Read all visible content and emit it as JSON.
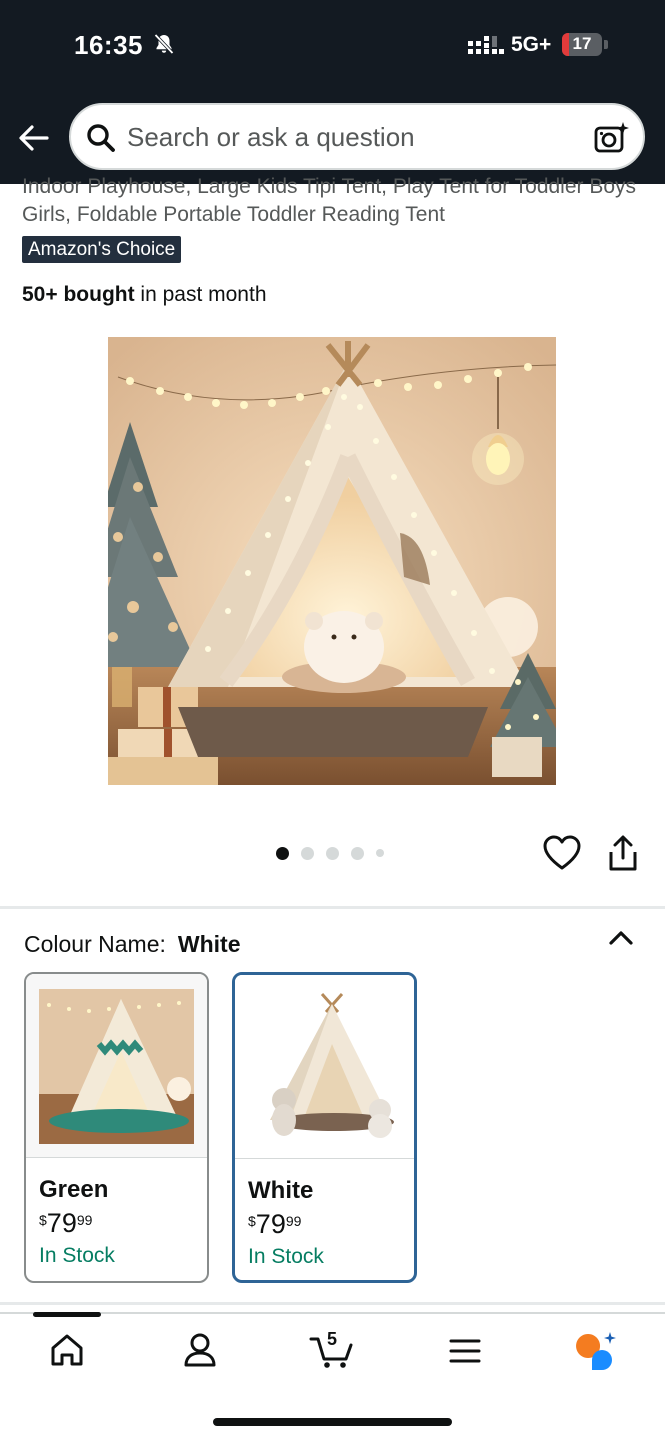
{
  "status_bar": {
    "time": "16:35",
    "network": "5G+",
    "battery": "17",
    "battery_level_percent": 17
  },
  "search": {
    "placeholder": "Search or ask a question"
  },
  "product": {
    "title": "Indoor Playhouse, Large Kids Tipi Tent, Play Tent for Toddler Boys Girls, Foldable Portable Toddler Reading Tent",
    "badge": "Amazon's Choice",
    "bought_bold": "50+ bought",
    "bought_rest": " in past month",
    "image_count": 5,
    "image_active_index": 0
  },
  "colour": {
    "label": "Colour Name:",
    "selected": "White",
    "options": [
      {
        "name": "Green",
        "currency": "$",
        "price_whole": "79",
        "price_fraction": "99",
        "stock": "In Stock",
        "selected": false
      },
      {
        "name": "White",
        "currency": "$",
        "price_whole": "79",
        "price_fraction": "99",
        "stock": "In Stock",
        "selected": true
      }
    ]
  },
  "bottom_nav": {
    "items": [
      "home-icon",
      "account-icon",
      "cart-icon",
      "menu-icon",
      "rufus-icon"
    ],
    "cart_count": "5"
  },
  "colors": {
    "header_bg": "#131a22",
    "selected_border": "#2e6496",
    "in_stock": "#067d62",
    "badge_bg": "#232f3e",
    "rufus_orange": "#f47c20",
    "rufus_blue": "#1a8cff"
  }
}
